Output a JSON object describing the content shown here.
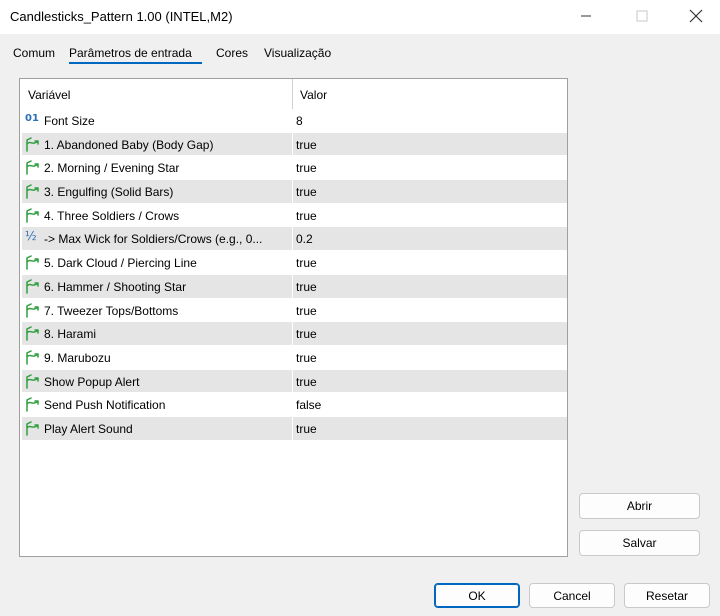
{
  "window": {
    "title": "Candlesticks_Pattern 1.00 (INTEL,M2)",
    "minimize_glyph": "—",
    "maximize_glyph": "☐",
    "close_glyph": "✕"
  },
  "tabs": [
    {
      "label": "Comum",
      "active": false
    },
    {
      "label": "Parâmetros de entrada",
      "active": true
    },
    {
      "label": "Cores",
      "active": false
    },
    {
      "label": "Visualização",
      "active": false
    }
  ],
  "grid": {
    "col_variable": "Variável",
    "col_value": "Valor",
    "rows": [
      {
        "name": "Font Size",
        "value": "8",
        "icon": "integer-icon"
      },
      {
        "name": "1. Abandoned Baby (Body Gap)",
        "value": "true",
        "icon": "boolean-icon"
      },
      {
        "name": "2. Morning / Evening Star",
        "value": "true",
        "icon": "boolean-icon"
      },
      {
        "name": "3. Engulfing (Solid Bars)",
        "value": "true",
        "icon": "boolean-icon"
      },
      {
        "name": "4. Three Soldiers / Crows",
        "value": "true",
        "icon": "boolean-icon"
      },
      {
        "name": "-> Max Wick for Soldiers/Crows (e.g., 0...",
        "value": "0.2",
        "icon": "fraction-icon"
      },
      {
        "name": "5. Dark Cloud / Piercing Line",
        "value": "true",
        "icon": "boolean-icon"
      },
      {
        "name": "6. Hammer / Shooting Star",
        "value": "true",
        "icon": "boolean-icon"
      },
      {
        "name": "7. Tweezer Tops/Bottoms",
        "value": "true",
        "icon": "boolean-icon"
      },
      {
        "name": "8. Harami",
        "value": "true",
        "icon": "boolean-icon"
      },
      {
        "name": "9. Marubozu",
        "value": "true",
        "icon": "boolean-icon"
      },
      {
        "name": "Show Popup Alert",
        "value": "true",
        "icon": "boolean-icon"
      },
      {
        "name": "Send Push Notification",
        "value": "false",
        "icon": "boolean-icon"
      },
      {
        "name": "Play Alert Sound",
        "value": "true",
        "icon": "boolean-icon"
      }
    ]
  },
  "side_buttons": {
    "open": "Abrir",
    "save": "Salvar"
  },
  "footer_buttons": {
    "ok": "OK",
    "cancel": "Cancel",
    "reset": "Resetar"
  },
  "icon_glyphs": {
    "integer": "01",
    "fraction": "½"
  },
  "colors": {
    "accent": "#0067c0",
    "icon_green": "#2e9e3e",
    "icon_blue": "#2a6fb5",
    "row_alt": "#e5e5e5"
  }
}
